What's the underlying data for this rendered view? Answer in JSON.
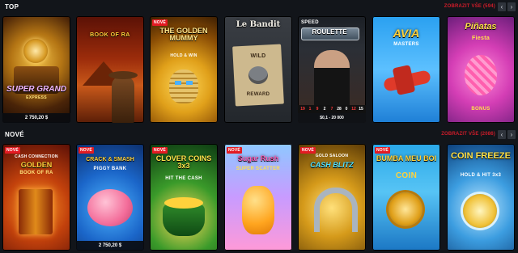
{
  "sections": {
    "top": {
      "title": "TOP",
      "show_all": "ZOBRAZIT VŠE (594)"
    },
    "new": {
      "title": "NOVÉ",
      "show_all": "ZOBRAZIT VŠE (2086)"
    }
  },
  "arrows": {
    "prev": "‹",
    "next": "›"
  },
  "top_games": [
    {
      "title": "SUPER GRAND",
      "subtitle": "EXPRESS",
      "jackpot": "2 750,20 $"
    },
    {
      "title": "BOOK OF RA"
    },
    {
      "badge": "NOVÉ",
      "title": "THE GOLDEN MUMMY",
      "subtitle": "HOLD & WIN"
    },
    {
      "title": "Le Bandit",
      "sign_top": "WILD",
      "sign_bottom": "REWARD"
    },
    {
      "title": "ROULETTE",
      "brand": "SPEED",
      "numbers": [
        "19",
        "1",
        "9",
        "2",
        "7",
        "28",
        "0",
        "12",
        "15"
      ],
      "limits": "$0,1 - 20 000"
    },
    {
      "title": "AVIA",
      "subtitle": "MASTERS"
    },
    {
      "title": "Piñatas",
      "subtitle": "Fiesta",
      "tag": "BONUS"
    }
  ],
  "new_games": [
    {
      "badge": "NOVÉ",
      "brand": "CASH CONNECTION",
      "title": "GOLDEN",
      "subtitle": "BOOK OF RA"
    },
    {
      "badge": "NOVÉ",
      "title": "CRACK & SMASH",
      "subtitle": "PIGGY BANK",
      "jackpot": "2 750,20 $"
    },
    {
      "badge": "NOVÉ",
      "title": "CLOVER COINS 3x3",
      "subtitle": "HIT THE CASH"
    },
    {
      "badge": "NOVÉ",
      "title": "Sugar Rush",
      "subtitle": "SUPER SCATTER"
    },
    {
      "badge": "NOVÉ",
      "brand": "GOLD SALOON",
      "title": "CASH BLITZ"
    },
    {
      "badge": "NOVÉ",
      "title": "BUMBA MEU BOI",
      "subtitle": "COIN"
    },
    {
      "badge": "NOVÉ",
      "title": "COIN FREEZE",
      "subtitle": "HOLD & HIT 3x3"
    }
  ],
  "colors": {
    "accent_red": "#d01c2a",
    "badge_red": "#e31b23",
    "background": "#12151a"
  }
}
